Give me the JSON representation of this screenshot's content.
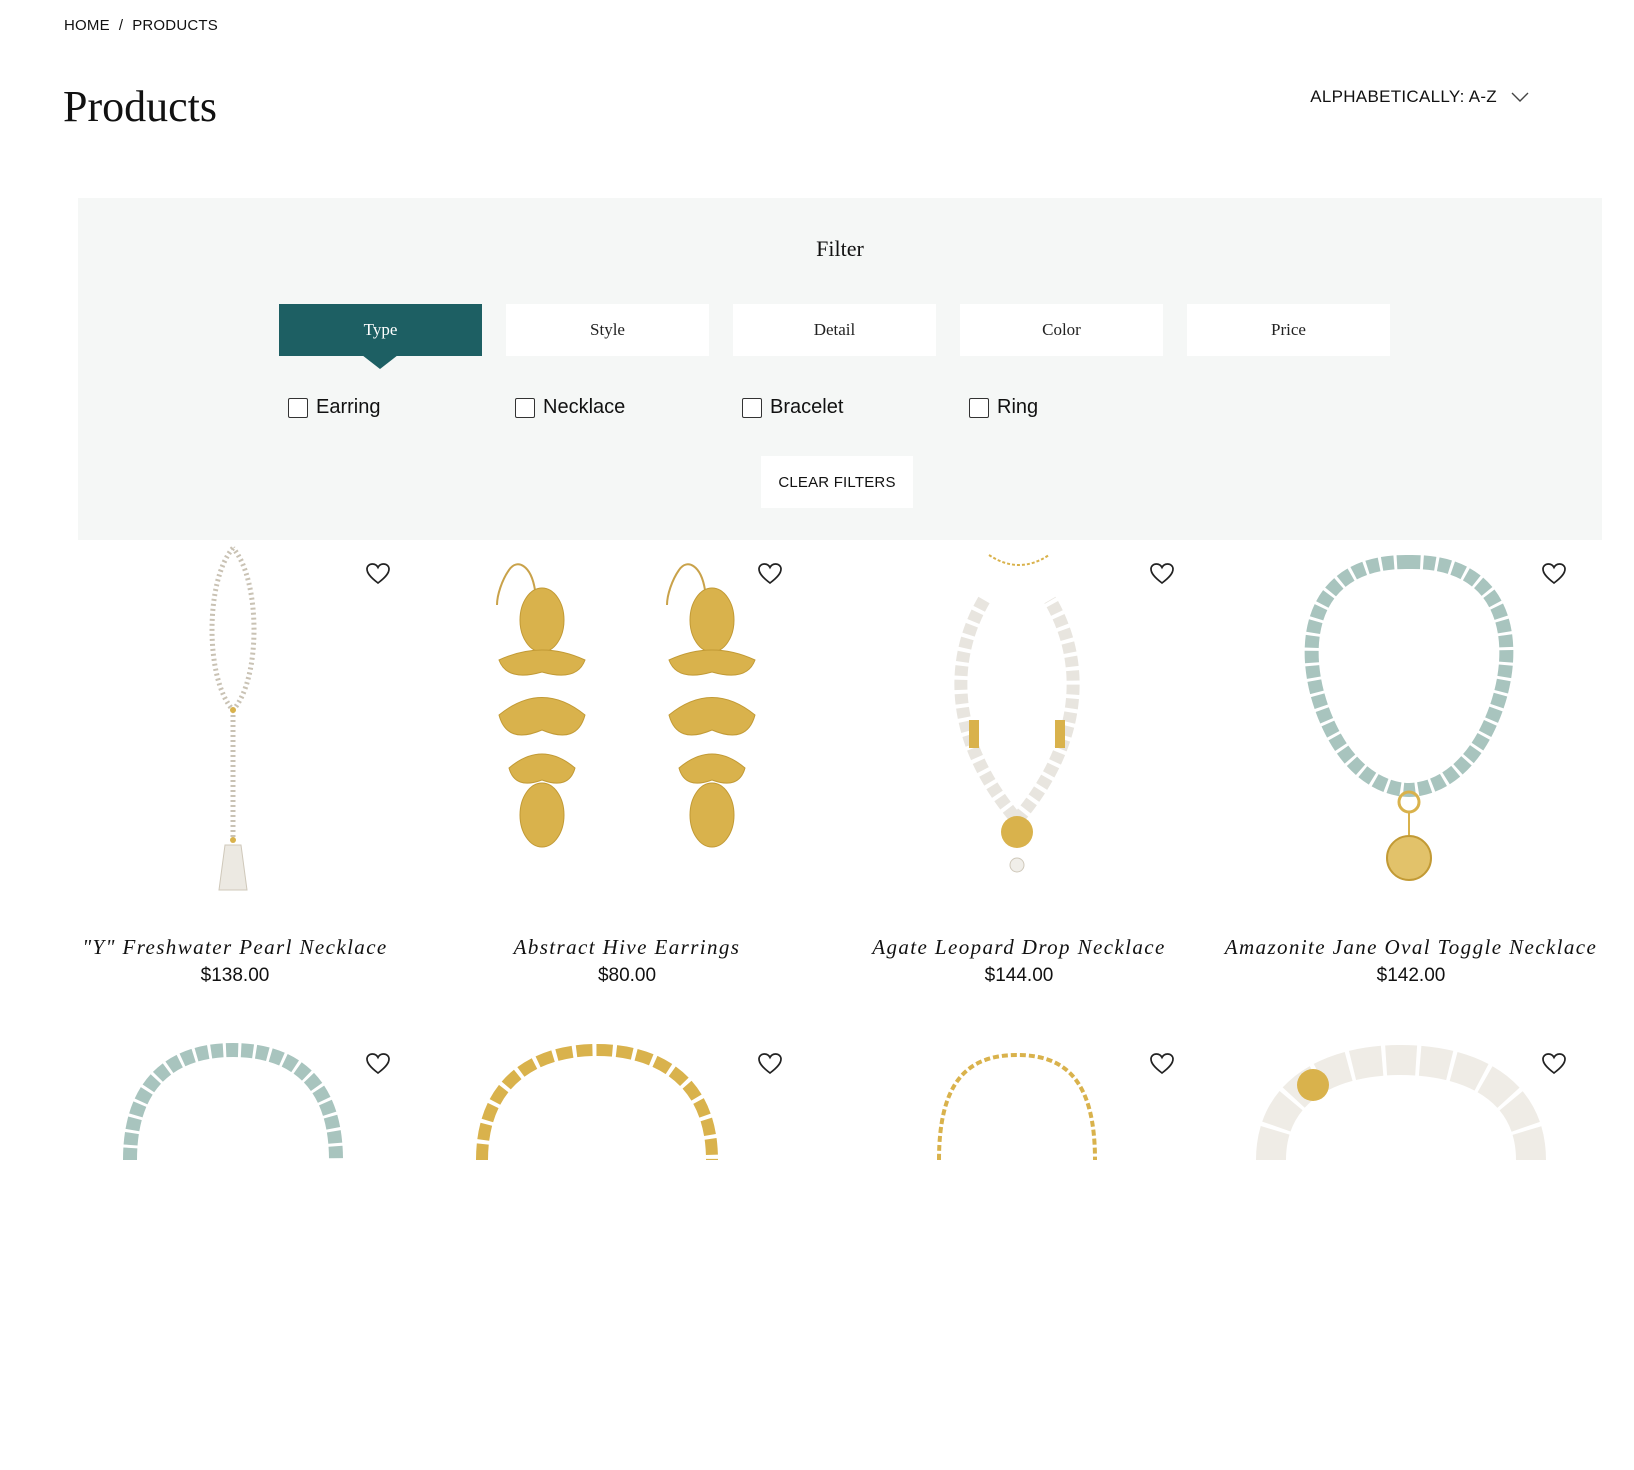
{
  "breadcrumb": {
    "home": "HOME",
    "separator": "/",
    "current": "PRODUCTS"
  },
  "page_title": "Products",
  "sort": {
    "label": "ALPHABETICALLY: A-Z",
    "icon": "chevron-down-icon"
  },
  "filter": {
    "title": "Filter",
    "tabs": [
      {
        "label": "Type",
        "active": true
      },
      {
        "label": "Style",
        "active": false
      },
      {
        "label": "Detail",
        "active": false
      },
      {
        "label": "Color",
        "active": false
      },
      {
        "label": "Price",
        "active": false
      }
    ],
    "options": [
      {
        "label": "Earring",
        "checked": false
      },
      {
        "label": "Necklace",
        "checked": false
      },
      {
        "label": "Bracelet",
        "checked": false
      },
      {
        "label": "Ring",
        "checked": false
      }
    ],
    "clear_label": "CLEAR FILTERS"
  },
  "products": [
    {
      "name": "\"Y\" Freshwater Pearl Necklace",
      "price": "$138.00"
    },
    {
      "name": "Abstract Hive Earrings",
      "price": "$80.00"
    },
    {
      "name": "Agate Leopard Drop Necklace",
      "price": "$144.00"
    },
    {
      "name": "Amazonite Jane Oval Toggle Necklace",
      "price": "$142.00"
    },
    {
      "name": "",
      "price": ""
    },
    {
      "name": "",
      "price": ""
    },
    {
      "name": "",
      "price": ""
    },
    {
      "name": "",
      "price": ""
    }
  ],
  "colors": {
    "accent": "#1d5f63",
    "panel_bg": "#f5f7f6",
    "gold": "#d9b24c"
  }
}
